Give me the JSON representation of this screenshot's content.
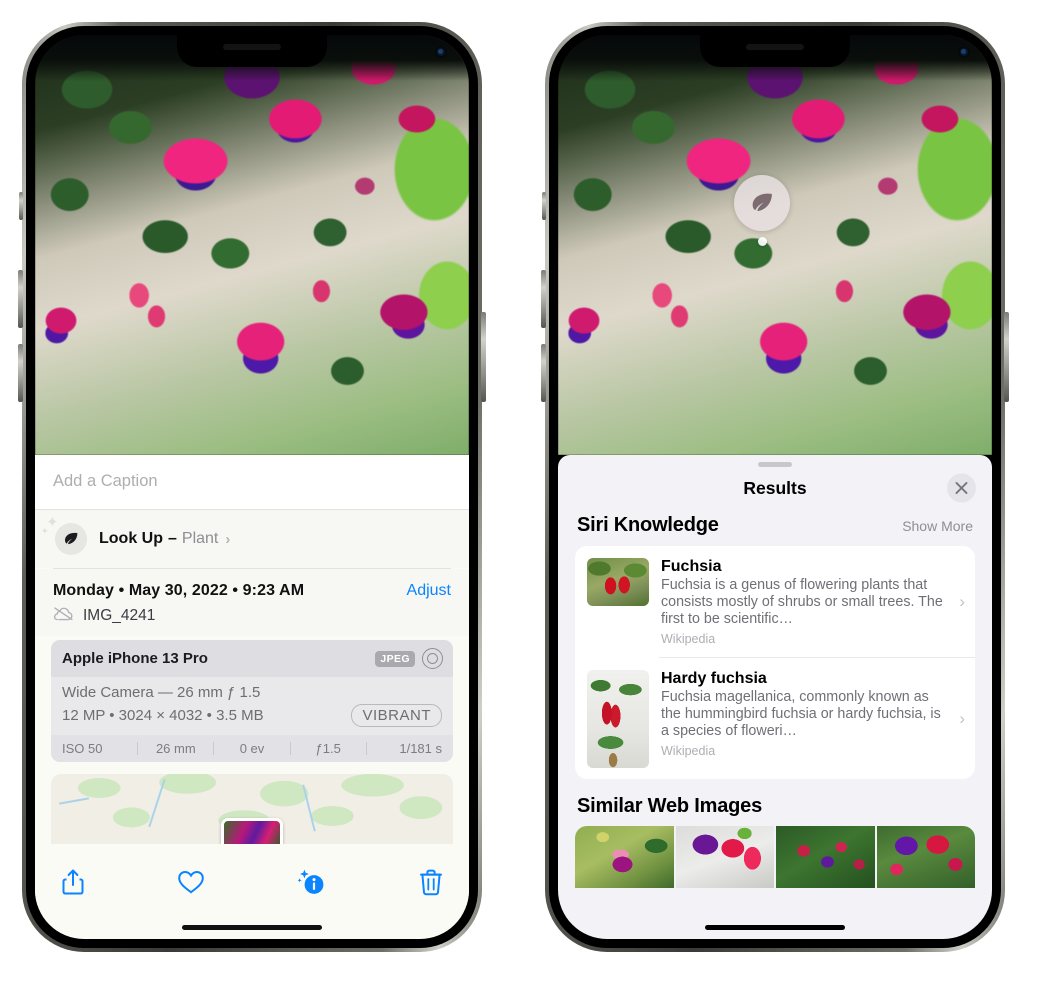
{
  "left_phone": {
    "caption": {
      "placeholder": "Add a Caption",
      "value": ""
    },
    "look_up": {
      "label": "Look Up",
      "dash": "–",
      "subject": "Plant",
      "icon": "leaf-icon",
      "chevron": "›"
    },
    "info": {
      "date": "Monday • May 30, 2022 • 9:23 AM",
      "adjust_label": "Adjust",
      "filename": "IMG_4241",
      "cloud_icon": "cloud-slash-icon"
    },
    "exif": {
      "device": "Apple iPhone 13 Pro",
      "format_chip": "JPEG",
      "lens_icon": "lens-icon",
      "lens_line": "Wide Camera — 26 mm ƒ 1.5",
      "size_line": "12 MP • 3024 × 4032 • 3.5 MB",
      "style_chip": "VIBRANT",
      "stats": [
        "ISO 50",
        "26 mm",
        "0 ev",
        "ƒ1.5",
        "1/181 s"
      ]
    },
    "toolbar": [
      {
        "name": "share-icon",
        "label": "Share"
      },
      {
        "name": "heart-icon",
        "label": "Favorite"
      },
      {
        "name": "info-sparkle-icon",
        "label": "Info"
      },
      {
        "name": "trash-icon",
        "label": "Delete"
      }
    ]
  },
  "right_phone": {
    "vlu_badge": {
      "icon": "leaf-icon"
    },
    "sheet": {
      "title": "Results",
      "close_icon": "close-icon",
      "sections": [
        {
          "title": "Siri Knowledge",
          "action": "Show More",
          "cards": [
            {
              "title": "Fuchsia",
              "description": "Fuchsia is a genus of flowering plants that consists mostly of shrubs or small trees. The first to be scientific…",
              "source": "Wikipedia",
              "chevron": "›"
            },
            {
              "title": "Hardy fuchsia",
              "description": "Fuchsia magellanica, commonly known as the hummingbird fuchsia or hardy fuchsia, is a species of floweri…",
              "source": "Wikipedia",
              "chevron": "›"
            }
          ]
        },
        {
          "title": "Similar Web Images",
          "action": "",
          "images": 4
        }
      ]
    }
  },
  "colors": {
    "accent_blue": "#0a84ff",
    "sheet_bg": "#f2f2f7",
    "card_bg": "#ffffff",
    "secondary_text": "#8e8e93"
  }
}
